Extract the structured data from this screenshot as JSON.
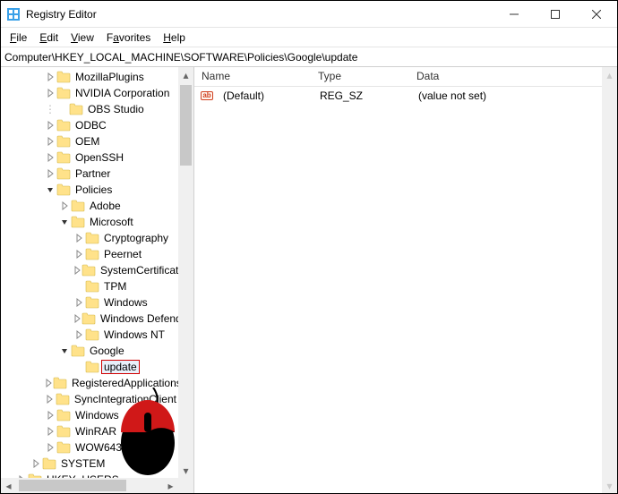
{
  "window": {
    "title": "Registry Editor"
  },
  "menu": {
    "file": "File",
    "edit": "Edit",
    "view": "View",
    "favorites": "Favorites",
    "help": "Help"
  },
  "address": "Computer\\HKEY_LOCAL_MACHINE\\SOFTWARE\\Policies\\Google\\update",
  "list": {
    "headers": {
      "name": "Name",
      "type": "Type",
      "data": "Data"
    },
    "rows": [
      {
        "name": "(Default)",
        "type": "REG_SZ",
        "data": "(value not set)"
      }
    ]
  },
  "tree": {
    "items": [
      {
        "depth": 3,
        "chev": "right",
        "label": "MozillaPlugins"
      },
      {
        "depth": 3,
        "chev": "right",
        "label": "NVIDIA Corporation"
      },
      {
        "depth": 3,
        "chev": "none",
        "label": "OBS Studio",
        "dots": true
      },
      {
        "depth": 3,
        "chev": "right",
        "label": "ODBC"
      },
      {
        "depth": 3,
        "chev": "right",
        "label": "OEM"
      },
      {
        "depth": 3,
        "chev": "right",
        "label": "OpenSSH"
      },
      {
        "depth": 3,
        "chev": "right",
        "label": "Partner"
      },
      {
        "depth": 3,
        "chev": "down",
        "label": "Policies"
      },
      {
        "depth": 4,
        "chev": "right",
        "label": "Adobe"
      },
      {
        "depth": 4,
        "chev": "down",
        "label": "Microsoft"
      },
      {
        "depth": 5,
        "chev": "right",
        "label": "Cryptography"
      },
      {
        "depth": 5,
        "chev": "right",
        "label": "Peernet"
      },
      {
        "depth": 5,
        "chev": "right",
        "label": "SystemCertificates"
      },
      {
        "depth": 5,
        "chev": "none",
        "label": "TPM"
      },
      {
        "depth": 5,
        "chev": "right",
        "label": "Windows"
      },
      {
        "depth": 5,
        "chev": "right",
        "label": "Windows Defender"
      },
      {
        "depth": 5,
        "chev": "right",
        "label": "Windows NT"
      },
      {
        "depth": 4,
        "chev": "down",
        "label": "Google"
      },
      {
        "depth": 5,
        "chev": "none",
        "label": "update",
        "selected": true
      },
      {
        "depth": 3,
        "chev": "right",
        "label": "RegisteredApplications"
      },
      {
        "depth": 3,
        "chev": "right",
        "label": "SyncIntegrationClient"
      },
      {
        "depth": 3,
        "chev": "right",
        "label": "Windows"
      },
      {
        "depth": 3,
        "chev": "right",
        "label": "WinRAR"
      },
      {
        "depth": 3,
        "chev": "right",
        "label": "WOW6432Node"
      },
      {
        "depth": 2,
        "chev": "right",
        "label": "SYSTEM"
      },
      {
        "depth": 1,
        "chev": "right",
        "label": "HKEY_USERS"
      }
    ]
  }
}
